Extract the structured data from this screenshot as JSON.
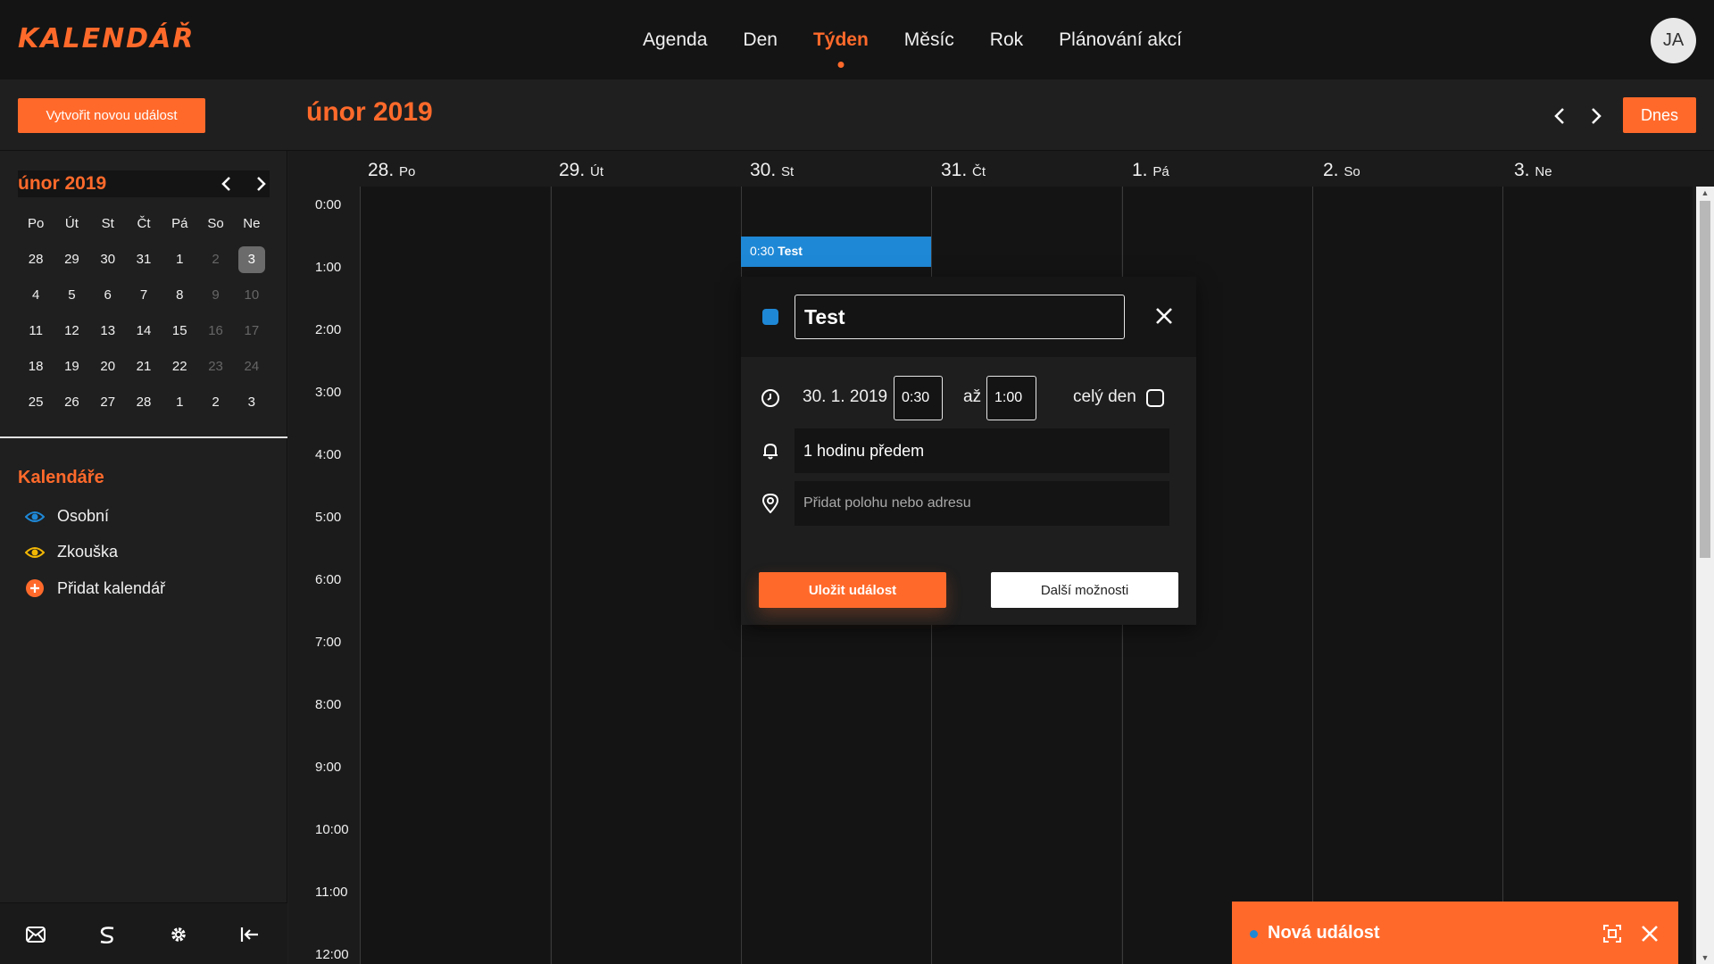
{
  "app": {
    "logo": "KALENDÁŘ",
    "avatar_initials": "JA"
  },
  "nav": {
    "items": [
      {
        "label": "Agenda",
        "active": false
      },
      {
        "label": "Den",
        "active": false
      },
      {
        "label": "Týden",
        "active": true
      },
      {
        "label": "Měsíc",
        "active": false
      },
      {
        "label": "Rok",
        "active": false
      },
      {
        "label": "Plánování akcí",
        "active": false
      }
    ]
  },
  "toolbar": {
    "create_label": "Vytvořit novou událost",
    "period_title": "únor 2019",
    "today_label": "Dnes"
  },
  "mini_calendar": {
    "title": "únor 2019",
    "weekdays": [
      "Po",
      "Út",
      "St",
      "Čt",
      "Pá",
      "So",
      "Ne"
    ],
    "weeks": [
      [
        "28",
        "29",
        "30",
        "31",
        "1",
        "2",
        "3"
      ],
      [
        "4",
        "5",
        "6",
        "7",
        "8",
        "9",
        "10"
      ],
      [
        "11",
        "12",
        "13",
        "14",
        "15",
        "16",
        "17"
      ],
      [
        "18",
        "19",
        "20",
        "21",
        "22",
        "23",
        "24"
      ],
      [
        "25",
        "26",
        "27",
        "28",
        "1",
        "2",
        "3"
      ]
    ],
    "selected": "3"
  },
  "calendars": {
    "title": "Kalendáře",
    "items": [
      {
        "label": "Osobní",
        "color": "#1f88d6"
      },
      {
        "label": "Zkouška",
        "color": "#f2b705"
      },
      {
        "label": "Přidat kalendář",
        "color": "#ff6a2b"
      }
    ]
  },
  "week": {
    "days": [
      {
        "num": "28.",
        "name": "Po"
      },
      {
        "num": "29.",
        "name": "Út"
      },
      {
        "num": "30.",
        "name": "St"
      },
      {
        "num": "31.",
        "name": "Čt"
      },
      {
        "num": "1.",
        "name": "Pá"
      },
      {
        "num": "2.",
        "name": "So"
      },
      {
        "num": "3.",
        "name": "Ne"
      }
    ],
    "hours": [
      "0:00",
      "1:00",
      "2:00",
      "3:00",
      "4:00",
      "5:00",
      "6:00",
      "7:00",
      "8:00",
      "9:00",
      "10:00",
      "11:00",
      "12:00"
    ]
  },
  "event": {
    "time": "0:30",
    "title": "Test",
    "color": "#1f88d6"
  },
  "popup": {
    "title_value": "Test",
    "date": "30. 1. 2019",
    "start": "0:30",
    "to_label": "až",
    "end": "1:00",
    "all_day_label": "celý den",
    "reminder": "1 hodinu předem",
    "location_placeholder": "Přidat polohu nebo adresu",
    "save_label": "Uložit událost",
    "more_label": "Další možnosti"
  },
  "new_event_panel": {
    "title": "Nová událost"
  },
  "colors": {
    "accent": "#ff6a2b",
    "event_blue": "#1f88d6"
  }
}
